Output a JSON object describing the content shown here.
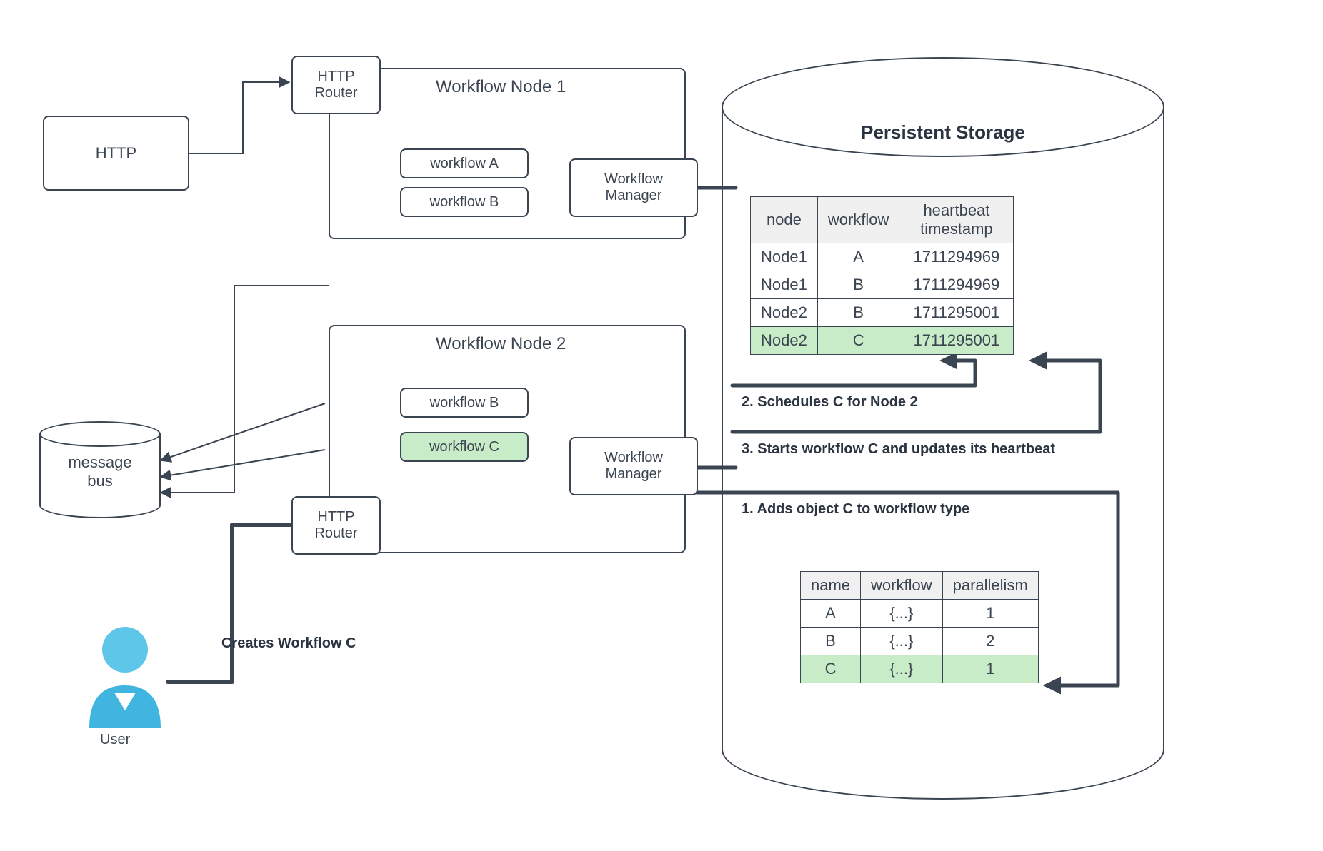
{
  "http_box": "HTTP",
  "http_router": "HTTP\nRouter",
  "workflow_manager": "Workflow\nManager",
  "message_bus": "message\nbus",
  "node1": {
    "title": "Workflow Node 1",
    "workflows": [
      "workflow A",
      "workflow B"
    ]
  },
  "node2": {
    "title": "Workflow Node 2",
    "workflows": [
      "workflow B",
      "workflow C"
    ]
  },
  "storage_title": "Persistent Storage",
  "table1": {
    "headers": [
      "node",
      "workflow",
      "heartbeat timestamp"
    ],
    "rows": [
      [
        "Node1",
        "A",
        "1711294969"
      ],
      [
        "Node1",
        "B",
        "1711294969"
      ],
      [
        "Node2",
        "B",
        "1711295001"
      ],
      [
        "Node2",
        "C",
        "1711295001"
      ]
    ],
    "highlight_row": 3
  },
  "table2": {
    "headers": [
      "name",
      "workflow",
      "parallelism"
    ],
    "rows": [
      [
        "A",
        "{...}",
        "1"
      ],
      [
        "B",
        "{...}",
        "2"
      ],
      [
        "C",
        "{...}",
        "1"
      ]
    ],
    "highlight_row": 2
  },
  "annotations": {
    "create": "Creates Workflow C",
    "step1": "1. Adds object C to workflow type",
    "step2": "2. Schedules C for Node 2",
    "step3": "3. Starts workflow C and updates its heartbeat"
  },
  "user_label": "User"
}
